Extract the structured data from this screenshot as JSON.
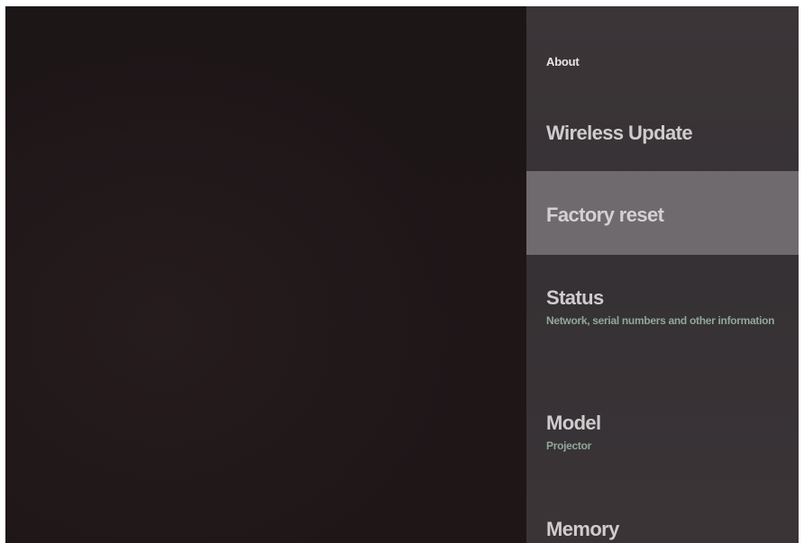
{
  "panel": {
    "header": "About",
    "items": [
      {
        "title": "Wireless Update",
        "subtitle": ""
      },
      {
        "title": "Factory reset",
        "subtitle": ""
      },
      {
        "title": "Status",
        "subtitle": "Network, serial numbers and other information"
      },
      {
        "title": "Model",
        "subtitle": "Projector"
      },
      {
        "title": "Memory",
        "subtitle": ""
      }
    ],
    "selected_item": "Factory reset"
  },
  "colors": {
    "background": "#1e1617",
    "panel": "#383235",
    "selected_row": "#6e6a6d",
    "subtitle": "#8fa89b"
  }
}
